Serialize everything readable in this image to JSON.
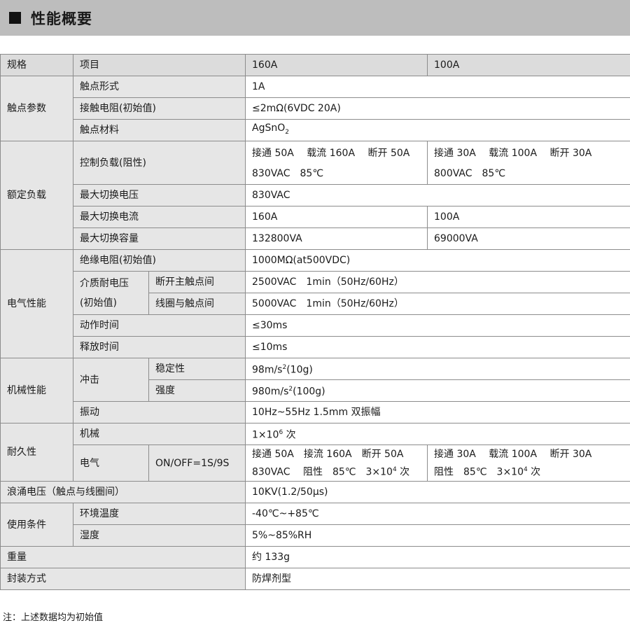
{
  "header": {
    "title": "性能概要"
  },
  "table": {
    "col_spec": "规格",
    "col_item": "项目",
    "col_160": "160A",
    "col_100": "100A",
    "contact_group": "触点参数",
    "contact_form_label": "触点形式",
    "contact_form_value": "1A",
    "contact_resistance_label": "接触电阻(初始值)",
    "contact_resistance_value": "≤2mΩ(6VDC 20A)",
    "contact_material_label": "触点材料",
    "contact_material_prefix": "AgSnO",
    "contact_material_sub": "2",
    "rated_group": "额定负载",
    "control_load_label": "控制负载(阻性)",
    "control_load_160_line1": "接通 50A　 载流 160A　 断开 50A",
    "control_load_160_line2": "830VAC　85℃",
    "control_load_100_line1": "接通 30A　 载流 100A　 断开 30A",
    "control_load_100_line2": "800VAC　85℃",
    "max_voltage_label": "最大切换电压",
    "max_voltage_value": "830VAC",
    "max_current_label": "最大切换电流",
    "max_current_160": "160A",
    "max_current_100": "100A",
    "max_capacity_label": "最大切换容量",
    "max_capacity_160": "132800VA",
    "max_capacity_100": "69000VA",
    "electrical_group": "电气性能",
    "insulation_label": "绝缘电阻(初始值)",
    "insulation_value": "1000MΩ(at500VDC)",
    "dielectric_label_line1": "介质耐电压",
    "dielectric_label_line2": "(初始值)",
    "dielectric_main_label": "断开主触点间",
    "dielectric_main_value": "2500VAC　1min（50Hz/60Hz）",
    "dielectric_coil_label": "线圈与触点间",
    "dielectric_coil_value": "5000VAC　1min（50Hz/60Hz）",
    "operate_time_label": "动作时间",
    "operate_time_value": "≤30ms",
    "release_time_label": "释放时间",
    "release_time_value": "≤10ms",
    "mechanical_group": "机械性能",
    "shock_label": "冲击",
    "stability_label": "稳定性",
    "stability_prefix": "98m/s",
    "stability_sup": "2",
    "stability_suffix": "(10g)",
    "strength_label": "强度",
    "strength_prefix": "980m/s",
    "strength_sup": "2",
    "strength_suffix": "(100g)",
    "vibration_label": "振动",
    "vibration_value": "10Hz~55Hz 1.5mm 双振幅",
    "durability_group": "耐久性",
    "mech_life_label": "机械",
    "mech_life_prefix": "1×10",
    "mech_life_sup": "6",
    "mech_life_suffix": " 次",
    "elec_life_label": "电气",
    "elec_life_condition": "ON/OFF=1S/9S",
    "elec_life_160_line1": "接通 50A　接流 160A　断开 50A",
    "elec_life_160_line2_prefix": "830VAC　 阻性　85℃　3×10",
    "elec_life_160_line2_sup": "4",
    "elec_life_160_line2_suffix": " 次",
    "elec_life_100_line1": "接通 30A　 载流 100A　 断开 30A",
    "elec_life_100_line2_prefix": "阻性　85℃　3×10",
    "elec_life_100_line2_sup": "4",
    "elec_life_100_line2_suffix": " 次",
    "surge_label": "浪涌电压（触点与线圈间）",
    "surge_value": "10KV(1.2/50μs)",
    "conditions_group": "使用条件",
    "ambient_temp_label": "环境温度",
    "ambient_temp_value": "-40℃~+85℃",
    "humidity_label": "湿度",
    "humidity_value": "5%~85%RH",
    "weight_label": "重量",
    "weight_value": "约 133g",
    "sealing_label": "封装方式",
    "sealing_value": "防焊剂型"
  },
  "footnote": "注：上述数据均为初始值"
}
